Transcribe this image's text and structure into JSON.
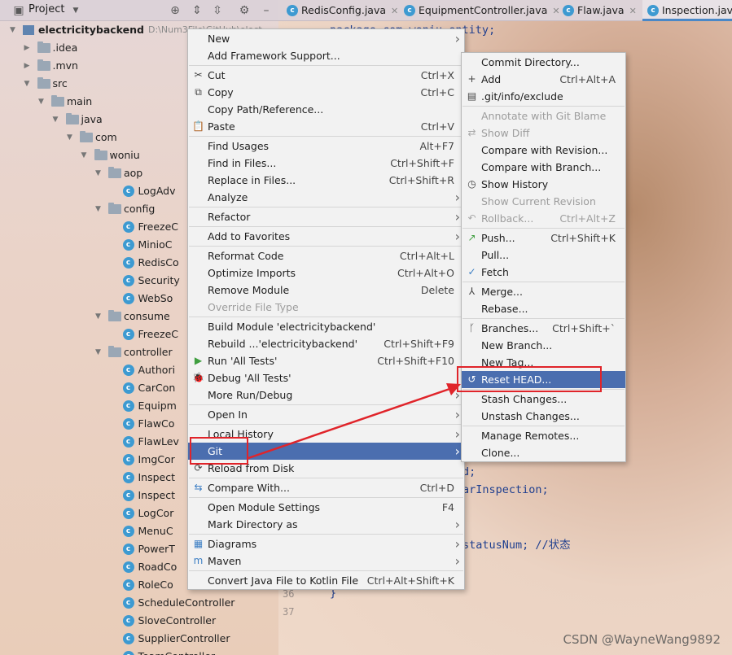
{
  "project_panel": {
    "title": "Project",
    "tree": [
      {
        "label": "electricitybackend",
        "extra": "D:\\Num3File\\GitHub\\elect",
        "depth": 0,
        "kind": "module",
        "open": true
      },
      {
        "label": ".idea",
        "depth": 1,
        "kind": "folder",
        "open": false
      },
      {
        "label": ".mvn",
        "depth": 1,
        "kind": "folder",
        "open": false
      },
      {
        "label": "src",
        "depth": 1,
        "kind": "folder",
        "open": true
      },
      {
        "label": "main",
        "depth": 2,
        "kind": "folder",
        "open": true
      },
      {
        "label": "java",
        "depth": 3,
        "kind": "folder",
        "open": true
      },
      {
        "label": "com",
        "depth": 4,
        "kind": "folder",
        "open": true
      },
      {
        "label": "woniu",
        "depth": 5,
        "kind": "folder",
        "open": true
      },
      {
        "label": "aop",
        "depth": 6,
        "kind": "folder",
        "open": true
      },
      {
        "label": "LogAdv",
        "depth": 7,
        "kind": "class"
      },
      {
        "label": "config",
        "depth": 6,
        "kind": "folder",
        "open": true
      },
      {
        "label": "FreezeC",
        "depth": 7,
        "kind": "class"
      },
      {
        "label": "MinioC",
        "depth": 7,
        "kind": "class"
      },
      {
        "label": "RedisCo",
        "depth": 7,
        "kind": "class"
      },
      {
        "label": "Security",
        "depth": 7,
        "kind": "class"
      },
      {
        "label": "WebSo",
        "depth": 7,
        "kind": "class"
      },
      {
        "label": "consume",
        "depth": 6,
        "kind": "folder",
        "open": true
      },
      {
        "label": "FreezeC",
        "depth": 7,
        "kind": "class"
      },
      {
        "label": "controller",
        "depth": 6,
        "kind": "folder",
        "open": true
      },
      {
        "label": "Authori",
        "depth": 7,
        "kind": "class"
      },
      {
        "label": "CarCon",
        "depth": 7,
        "kind": "class"
      },
      {
        "label": "Equipm",
        "depth": 7,
        "kind": "class"
      },
      {
        "label": "FlawCo",
        "depth": 7,
        "kind": "class"
      },
      {
        "label": "FlawLev",
        "depth": 7,
        "kind": "class"
      },
      {
        "label": "ImgCor",
        "depth": 7,
        "kind": "class"
      },
      {
        "label": "Inspect",
        "depth": 7,
        "kind": "class"
      },
      {
        "label": "Inspect",
        "depth": 7,
        "kind": "class"
      },
      {
        "label": "LogCor",
        "depth": 7,
        "kind": "class"
      },
      {
        "label": "MenuC",
        "depth": 7,
        "kind": "class"
      },
      {
        "label": "PowerT",
        "depth": 7,
        "kind": "class"
      },
      {
        "label": "RoadCo",
        "depth": 7,
        "kind": "class"
      },
      {
        "label": "RoleCo",
        "depth": 7,
        "kind": "class"
      },
      {
        "label": "ScheduleController",
        "depth": 7,
        "kind": "class"
      },
      {
        "label": "SloveController",
        "depth": 7,
        "kind": "class"
      },
      {
        "label": "SupplierController",
        "depth": 7,
        "kind": "class"
      },
      {
        "label": "TeamController",
        "depth": 7,
        "kind": "class"
      }
    ]
  },
  "tabs": [
    {
      "label": "RedisConfig.java",
      "active": false
    },
    {
      "label": "EquipmentController.java",
      "active": false
    },
    {
      "label": "Flaw.java",
      "active": false
    },
    {
      "label": "Inspection.java",
      "active": true
    }
  ],
  "editor": {
    "code_top": "package com.woniu.entity;",
    "code_fragments": [
      "d;",
      "arInspection;",
      "statusNum; //状态"
    ],
    "closing_brace": "}",
    "line_numbers": [
      "36",
      "37"
    ]
  },
  "context_menu": [
    {
      "label": "New",
      "submenu": true
    },
    {
      "label": "Add Framework Support..."
    },
    {
      "sep": true
    },
    {
      "label": "Cut",
      "shortcut": "Ctrl+X",
      "icon": "cut-icon",
      "glyph": "✂"
    },
    {
      "label": "Copy",
      "shortcut": "Ctrl+C",
      "icon": "copy-icon",
      "glyph": "⧉"
    },
    {
      "label": "Copy Path/Reference..."
    },
    {
      "label": "Paste",
      "shortcut": "Ctrl+V",
      "icon": "paste-icon",
      "glyph": "📋"
    },
    {
      "sep": true
    },
    {
      "label": "Find Usages",
      "shortcut": "Alt+F7"
    },
    {
      "label": "Find in Files...",
      "shortcut": "Ctrl+Shift+F"
    },
    {
      "label": "Replace in Files...",
      "shortcut": "Ctrl+Shift+R"
    },
    {
      "label": "Analyze",
      "submenu": true
    },
    {
      "sep": true
    },
    {
      "label": "Refactor",
      "submenu": true
    },
    {
      "sep": true
    },
    {
      "label": "Add to Favorites",
      "submenu": true
    },
    {
      "sep": true
    },
    {
      "label": "Reformat Code",
      "shortcut": "Ctrl+Alt+L"
    },
    {
      "label": "Optimize Imports",
      "shortcut": "Ctrl+Alt+O"
    },
    {
      "label": "Remove Module",
      "shortcut": "Delete"
    },
    {
      "label": "Override File Type",
      "disabled": true
    },
    {
      "sep": true
    },
    {
      "label": "Build Module 'electricitybackend'"
    },
    {
      "label": "Rebuild ...'electricitybackend'",
      "shortcut": "Ctrl+Shift+F9"
    },
    {
      "label": "Run 'All Tests'",
      "shortcut": "Ctrl+Shift+F10",
      "icon": "run-icon",
      "glyph": "▶",
      "color": "#3f9e3f"
    },
    {
      "label": "Debug 'All Tests'",
      "icon": "debug-icon",
      "glyph": "🐞",
      "color": "#3f9e3f"
    },
    {
      "label": "More Run/Debug",
      "submenu": true
    },
    {
      "sep": true
    },
    {
      "label": "Open In",
      "submenu": true
    },
    {
      "sep": true
    },
    {
      "label": "Local History",
      "submenu": true
    },
    {
      "label": "Git",
      "submenu": true,
      "selected": true
    },
    {
      "label": "Reload from Disk",
      "icon": "reload-icon",
      "glyph": "⟳"
    },
    {
      "sep": true
    },
    {
      "label": "Compare With...",
      "shortcut": "Ctrl+D",
      "icon": "compare-icon",
      "glyph": "⇆",
      "color": "#3d7fc4"
    },
    {
      "sep": true
    },
    {
      "label": "Open Module Settings",
      "shortcut": "F4"
    },
    {
      "label": "Mark Directory as",
      "submenu": true
    },
    {
      "sep": true
    },
    {
      "label": "Diagrams",
      "submenu": true,
      "icon": "diagrams-icon",
      "glyph": "▦",
      "color": "#3d7fc4"
    },
    {
      "label": "Maven",
      "submenu": true,
      "icon": "maven-icon",
      "glyph": "m",
      "color": "#3d7fc4"
    },
    {
      "sep": true
    },
    {
      "label": "Convert Java File to Kotlin File",
      "shortcut": "Ctrl+Alt+Shift+K"
    }
  ],
  "git_menu": [
    {
      "label": "Commit Directory..."
    },
    {
      "label": "Add",
      "shortcut": "Ctrl+Alt+A",
      "icon": "plus-icon",
      "glyph": "+"
    },
    {
      "label": ".git/info/exclude",
      "icon": "file-icon",
      "glyph": "▤"
    },
    {
      "sep": true
    },
    {
      "label": "Annotate with Git Blame",
      "disabled": true
    },
    {
      "label": "Show Diff",
      "disabled": true,
      "icon": "diff-icon",
      "glyph": "⇄"
    },
    {
      "label": "Compare with Revision..."
    },
    {
      "label": "Compare with Branch..."
    },
    {
      "label": "Show History",
      "icon": "history-icon",
      "glyph": "◷"
    },
    {
      "label": "Show Current Revision",
      "disabled": true
    },
    {
      "label": "Rollback...",
      "shortcut": "Ctrl+Alt+Z",
      "disabled": true,
      "icon": "rollback-icon",
      "glyph": "↶"
    },
    {
      "sep": true
    },
    {
      "label": "Push...",
      "shortcut": "Ctrl+Shift+K",
      "icon": "push-icon",
      "glyph": "↗",
      "color": "#3f9e3f"
    },
    {
      "label": "Pull...",
      "shortcut": ""
    },
    {
      "label": "Fetch",
      "icon": "fetch-icon",
      "glyph": "✓",
      "color": "#3d7fc4"
    },
    {
      "sep": true
    },
    {
      "label": "Merge...",
      "icon": "merge-icon",
      "glyph": "⅄"
    },
    {
      "label": "Rebase..."
    },
    {
      "sep": true
    },
    {
      "label": "Branches...",
      "shortcut": "Ctrl+Shift+`",
      "icon": "branch-icon",
      "glyph": "ᚴ"
    },
    {
      "label": "New Branch..."
    },
    {
      "label": "New Tag..."
    },
    {
      "label": "Reset HEAD...",
      "selected": true,
      "icon": "reset-icon",
      "glyph": "↺"
    },
    {
      "sep": true
    },
    {
      "label": "Stash Changes..."
    },
    {
      "label": "Unstash Changes..."
    },
    {
      "sep": true
    },
    {
      "label": "Manage Remotes..."
    },
    {
      "label": "Clone..."
    }
  ],
  "watermark": "CSDN @WayneWang9892",
  "colors": {
    "selection": "#4b6eaf",
    "annotation_red": "#e0242a"
  }
}
